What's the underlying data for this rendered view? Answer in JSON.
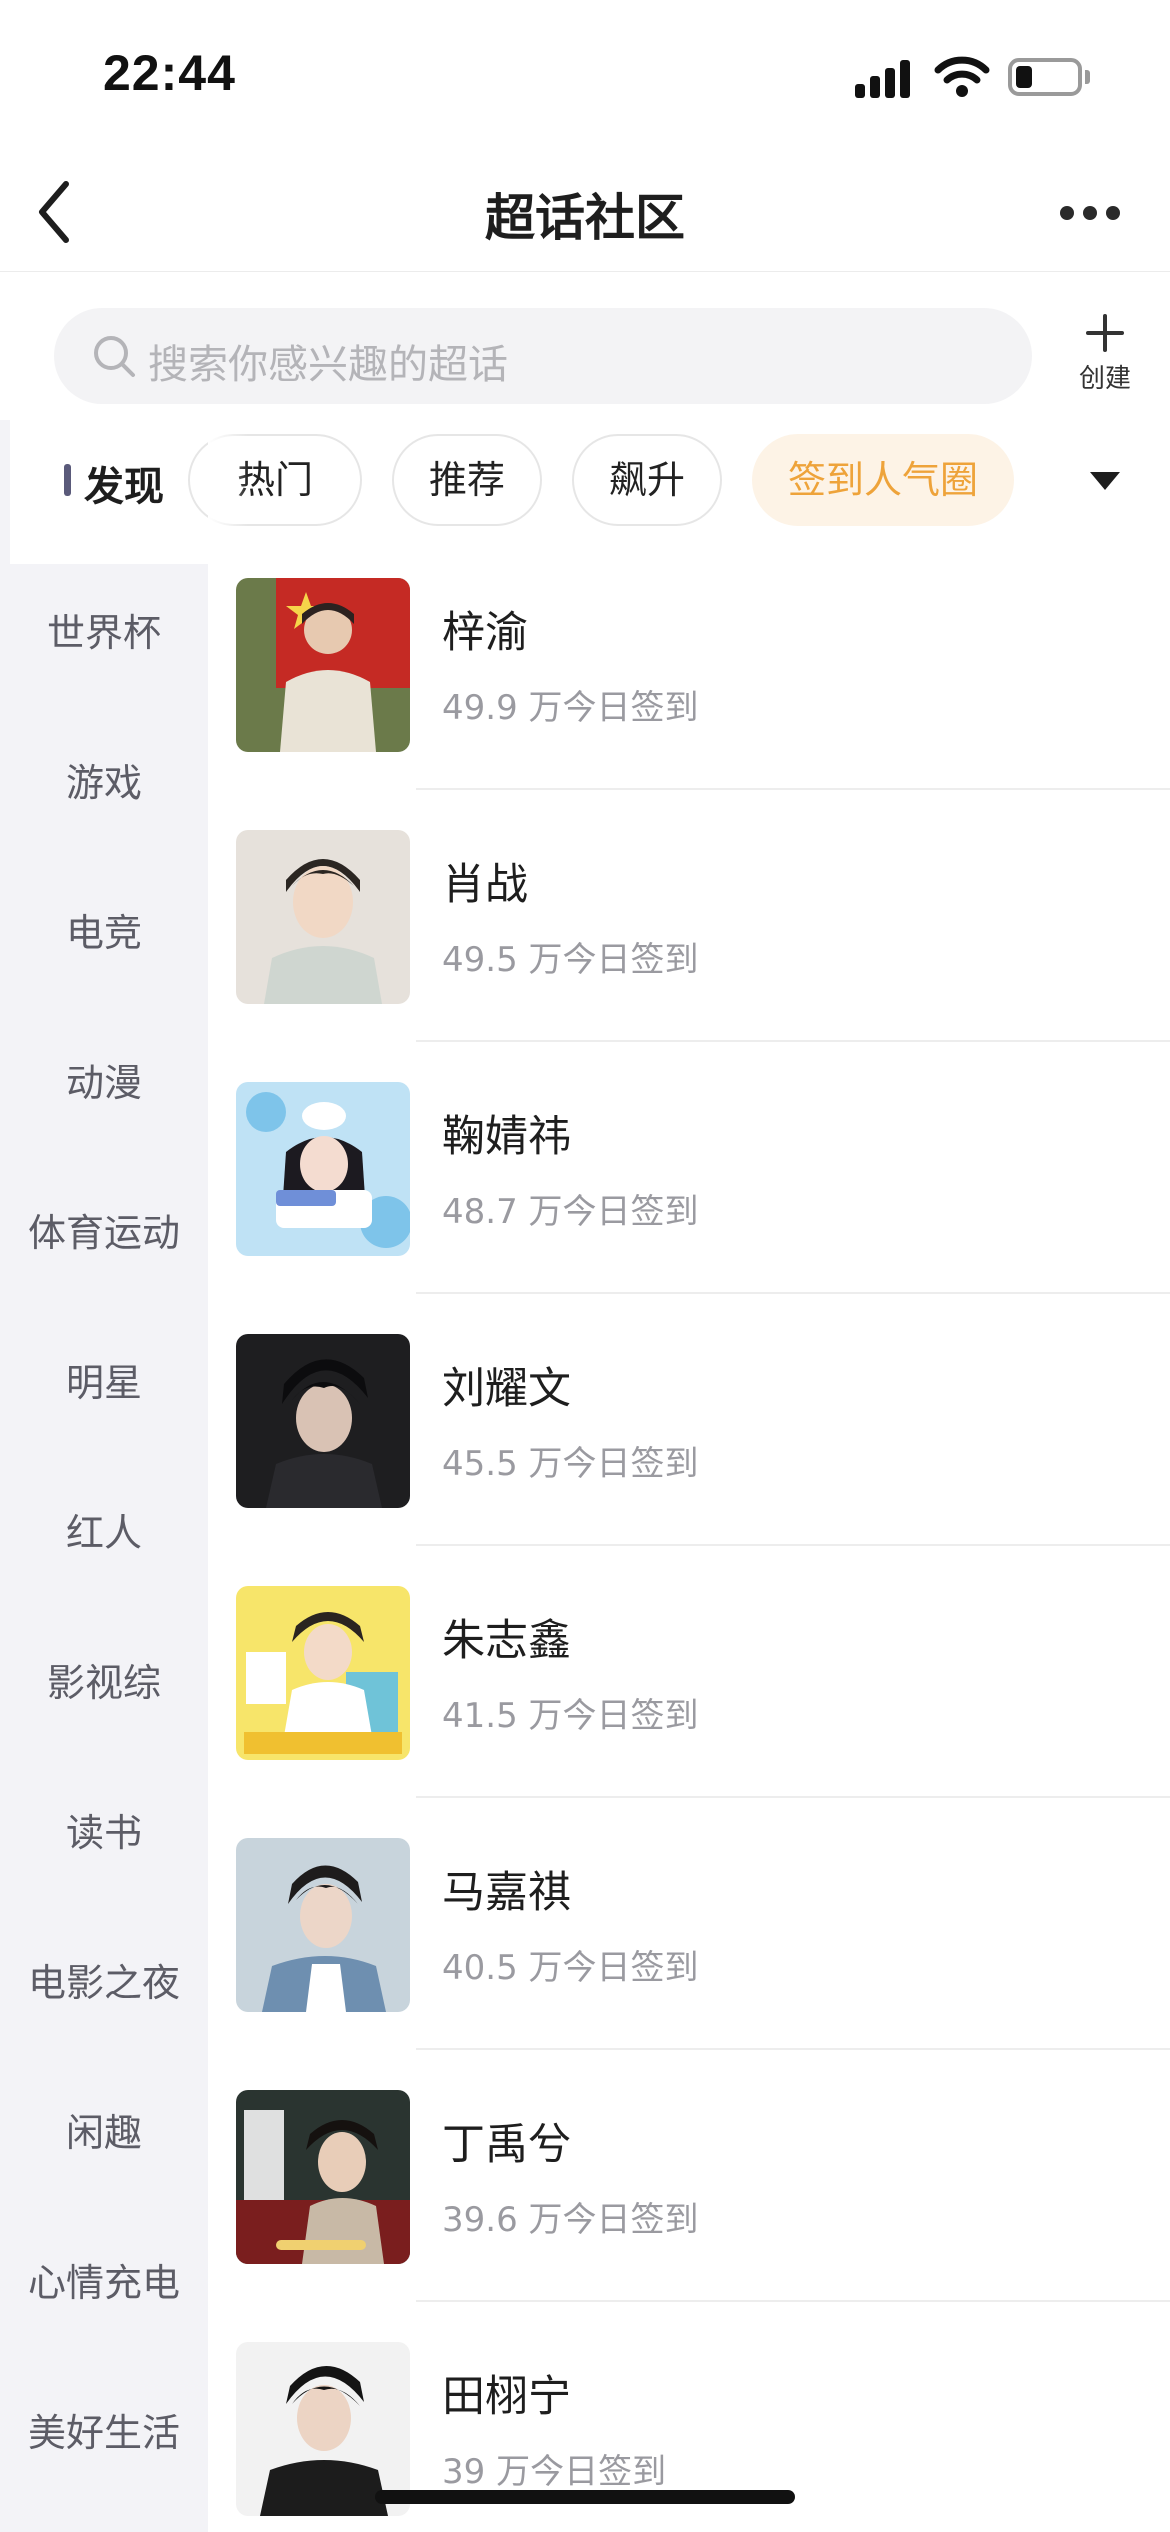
{
  "status_bar": {
    "time": "22:44"
  },
  "nav": {
    "title": "超话社区"
  },
  "search": {
    "placeholder": "搜索你感兴趣的超话"
  },
  "create": {
    "label": "创建"
  },
  "tabs": {
    "discover": "发现",
    "chips": [
      "热门",
      "推荐",
      "飙升",
      "签到人气圈"
    ],
    "active_chip": "签到人气圈"
  },
  "sidebar": {
    "items": [
      "世界杯",
      "游戏",
      "电竞",
      "动漫",
      "体育运动",
      "明星",
      "红人",
      "影视综",
      "读书",
      "电影之夜",
      "闲趣",
      "心情充电",
      "美好生活"
    ]
  },
  "list": [
    {
      "name": "梓渝",
      "count": "49.9 万今日签到",
      "thumb": "photo-flag-background"
    },
    {
      "name": "肖战",
      "count": "49.5 万今日签到",
      "thumb": "photo-portrait"
    },
    {
      "name": "鞠婧祎",
      "count": "48.7 万今日签到",
      "thumb": "photo-birthday-poster"
    },
    {
      "name": "刘耀文",
      "count": "45.5 万今日签到",
      "thumb": "photo-portrait-dark"
    },
    {
      "name": "朱志鑫",
      "count": "41.5 万今日签到",
      "thumb": "photo-yellow-poster"
    },
    {
      "name": "马嘉祺",
      "count": "40.5 万今日签到",
      "thumb": "photo-portrait"
    },
    {
      "name": "丁禹兮",
      "count": "39.6 万今日签到",
      "thumb": "photo-drama-poster"
    },
    {
      "name": "田栩宁",
      "count": "39 万今日签到",
      "thumb": "photo-portrait"
    }
  ],
  "colors": {
    "accent": "#eea33a",
    "accent_bg": "#fdf3e6",
    "sidebar_bg": "#f3f3f7"
  }
}
